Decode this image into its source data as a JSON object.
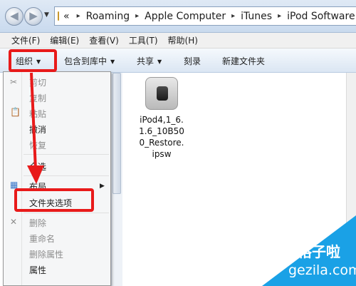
{
  "address_bar": {
    "overflow_chevron": "«",
    "crumbs": [
      "Roaming",
      "Apple Computer",
      "iTunes",
      "iPod Software Update"
    ],
    "separator": "▸"
  },
  "menu_bar": {
    "items": [
      "文件(F)",
      "编辑(E)",
      "查看(V)",
      "工具(T)",
      "帮助(H)"
    ]
  },
  "toolbar": {
    "organize": "组织",
    "include_in_library": "包含到库中",
    "share": "共享",
    "burn": "刻录",
    "new_folder": "新建文件夹",
    "caret": "▼"
  },
  "organize_menu": {
    "cut": "剪切",
    "copy": "复制",
    "paste": "粘贴",
    "undo": "撤消",
    "redo": "恢复",
    "select_all": "全选",
    "layout": "布局",
    "folder_options": "文件夹选项",
    "delete": "删除",
    "rename": "重命名",
    "remove_properties": "删除属性",
    "properties": "属性"
  },
  "file": {
    "name_lines": [
      "iPod4,1_6.",
      "1.6_10B50",
      "0_Restore.",
      "ipsw"
    ]
  },
  "watermark": {
    "line1": "格子啦",
    "line2": "gezila.com"
  },
  "colors": {
    "highlight_red": "#e81a1a",
    "watermark_blue": "#1aa1e6"
  }
}
